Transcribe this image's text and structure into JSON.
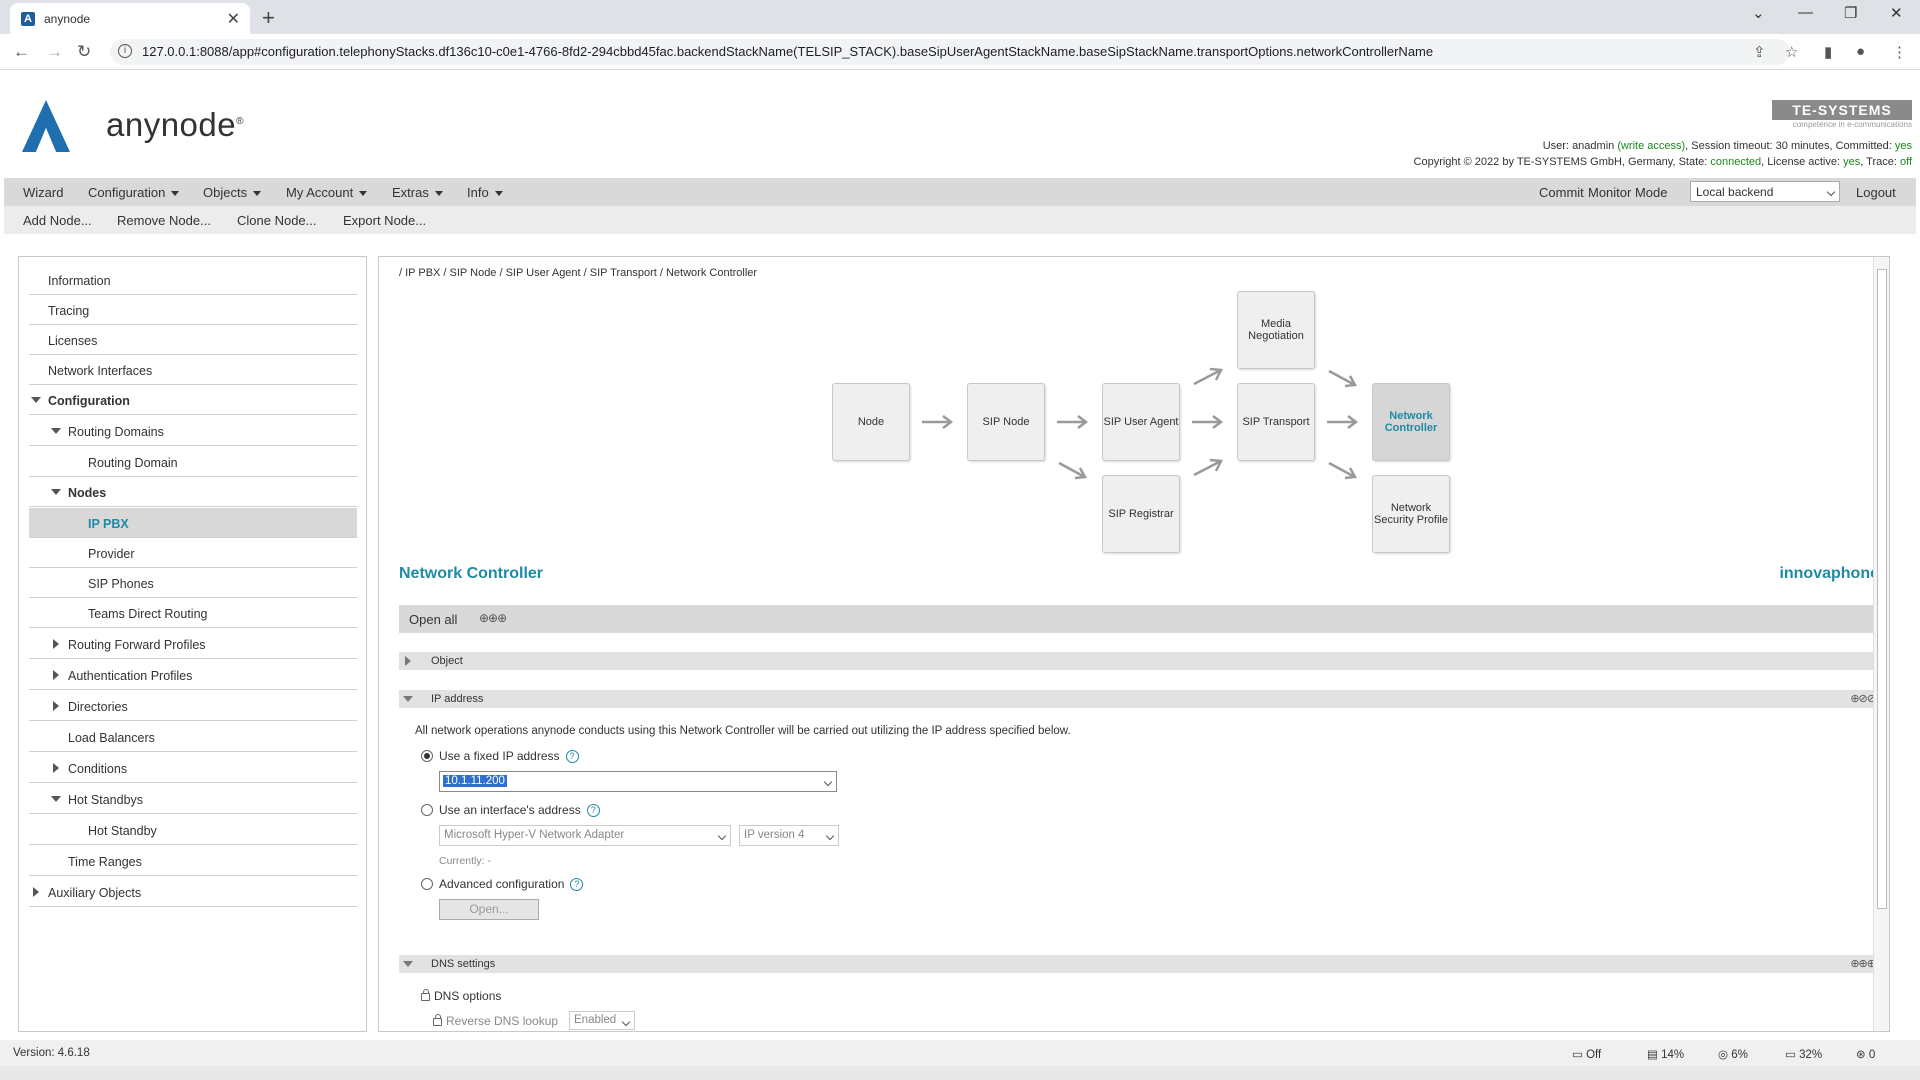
{
  "browser": {
    "tab_title": "anynode",
    "url": "127.0.0.1:8088/app#configuration.telephonyStacks.df136c10-c0e1-4766-8fd2-294cbbd45fac.backendStackName(TELSIP_STACK).baseSipUserAgentStackName.baseSipStackName.transportOptions.networkControllerName"
  },
  "header": {
    "brand": "anynode",
    "vendor_logo": "TE-SYSTEMS",
    "vendor_tagline": "competence in e-communications",
    "session_user_prefix": "User: ",
    "session_user": "anadmin",
    "session_access": "(write access)",
    "session_timeout": ", Session timeout: 30 minutes, Committed: ",
    "session_committed": "yes",
    "copyright": "Copyright © 2022 by TE-SYSTEMS GmbH, Germany, State: ",
    "state": "connected",
    "license_label": ", License active: ",
    "license": "yes",
    "trace_label": ", Trace: ",
    "trace": "off"
  },
  "menu": {
    "wizard": "Wizard",
    "configuration": "Configuration",
    "objects": "Objects",
    "my_account": "My Account",
    "extras": "Extras",
    "info": "Info",
    "commit": "Commit",
    "monitor_mode": "Monitor Mode",
    "backend": "Local backend",
    "logout": "Logout"
  },
  "toolbar": {
    "add_node": "Add Node...",
    "remove_node": "Remove Node...",
    "clone_node": "Clone Node...",
    "export_node": "Export Node..."
  },
  "sidebar": {
    "items": [
      {
        "label": "Information"
      },
      {
        "label": "Tracing"
      },
      {
        "label": "Licenses"
      },
      {
        "label": "Network Interfaces"
      },
      {
        "label": "Configuration"
      },
      {
        "label": "Routing Domains"
      },
      {
        "label": "Routing Domain"
      },
      {
        "label": "Nodes"
      },
      {
        "label": "IP PBX"
      },
      {
        "label": "Provider"
      },
      {
        "label": "SIP Phones"
      },
      {
        "label": "Teams Direct Routing"
      },
      {
        "label": "Routing Forward Profiles"
      },
      {
        "label": "Authentication Profiles"
      },
      {
        "label": "Directories"
      },
      {
        "label": "Load Balancers"
      },
      {
        "label": "Conditions"
      },
      {
        "label": "Hot Standbys"
      },
      {
        "label": "Hot Standby"
      },
      {
        "label": "Time Ranges"
      },
      {
        "label": "Auxiliary Objects"
      }
    ]
  },
  "main": {
    "breadcrumb": "/ IP PBX / SIP Node / SIP User Agent / SIP Transport / Network Controller",
    "diagram": {
      "node": "Node",
      "sip_node": "SIP Node",
      "sip_user_agent": "SIP User Agent",
      "sip_registrar": "SIP Registrar",
      "media_negotiation": "Media Negotiation",
      "sip_transport": "SIP Transport",
      "network_controller": "Network Controller",
      "network_security_profile": "Network Security Profile"
    },
    "title": "Network Controller",
    "vendor": "innovaphone",
    "open_all": "Open all",
    "sections": {
      "object": "Object",
      "ip_address": "IP address",
      "dns_settings": "DNS settings"
    },
    "ip_description": "All network operations anynode conducts using this Network Controller will be carried out utilizing the IP address specified below.",
    "use_fixed_ip": "Use a fixed IP address",
    "fixed_ip_value": "10.1.11.200",
    "use_interface": "Use an interface's address",
    "interface_adapter": "Microsoft Hyper-V Network Adapter",
    "ip_version": "IP version 4",
    "currently": "Currently: -",
    "advanced_config": "Advanced configuration",
    "open_button": "Open...",
    "dns_options": "DNS options",
    "reverse_dns_label": "Reverse DNS lookup",
    "reverse_dns_value": "Enabled"
  },
  "footer": {
    "version": "Version: 4.6.18",
    "record": "Off",
    "memory": "14%",
    "cpu": "6%",
    "disk": "32%",
    "calls": "0"
  }
}
